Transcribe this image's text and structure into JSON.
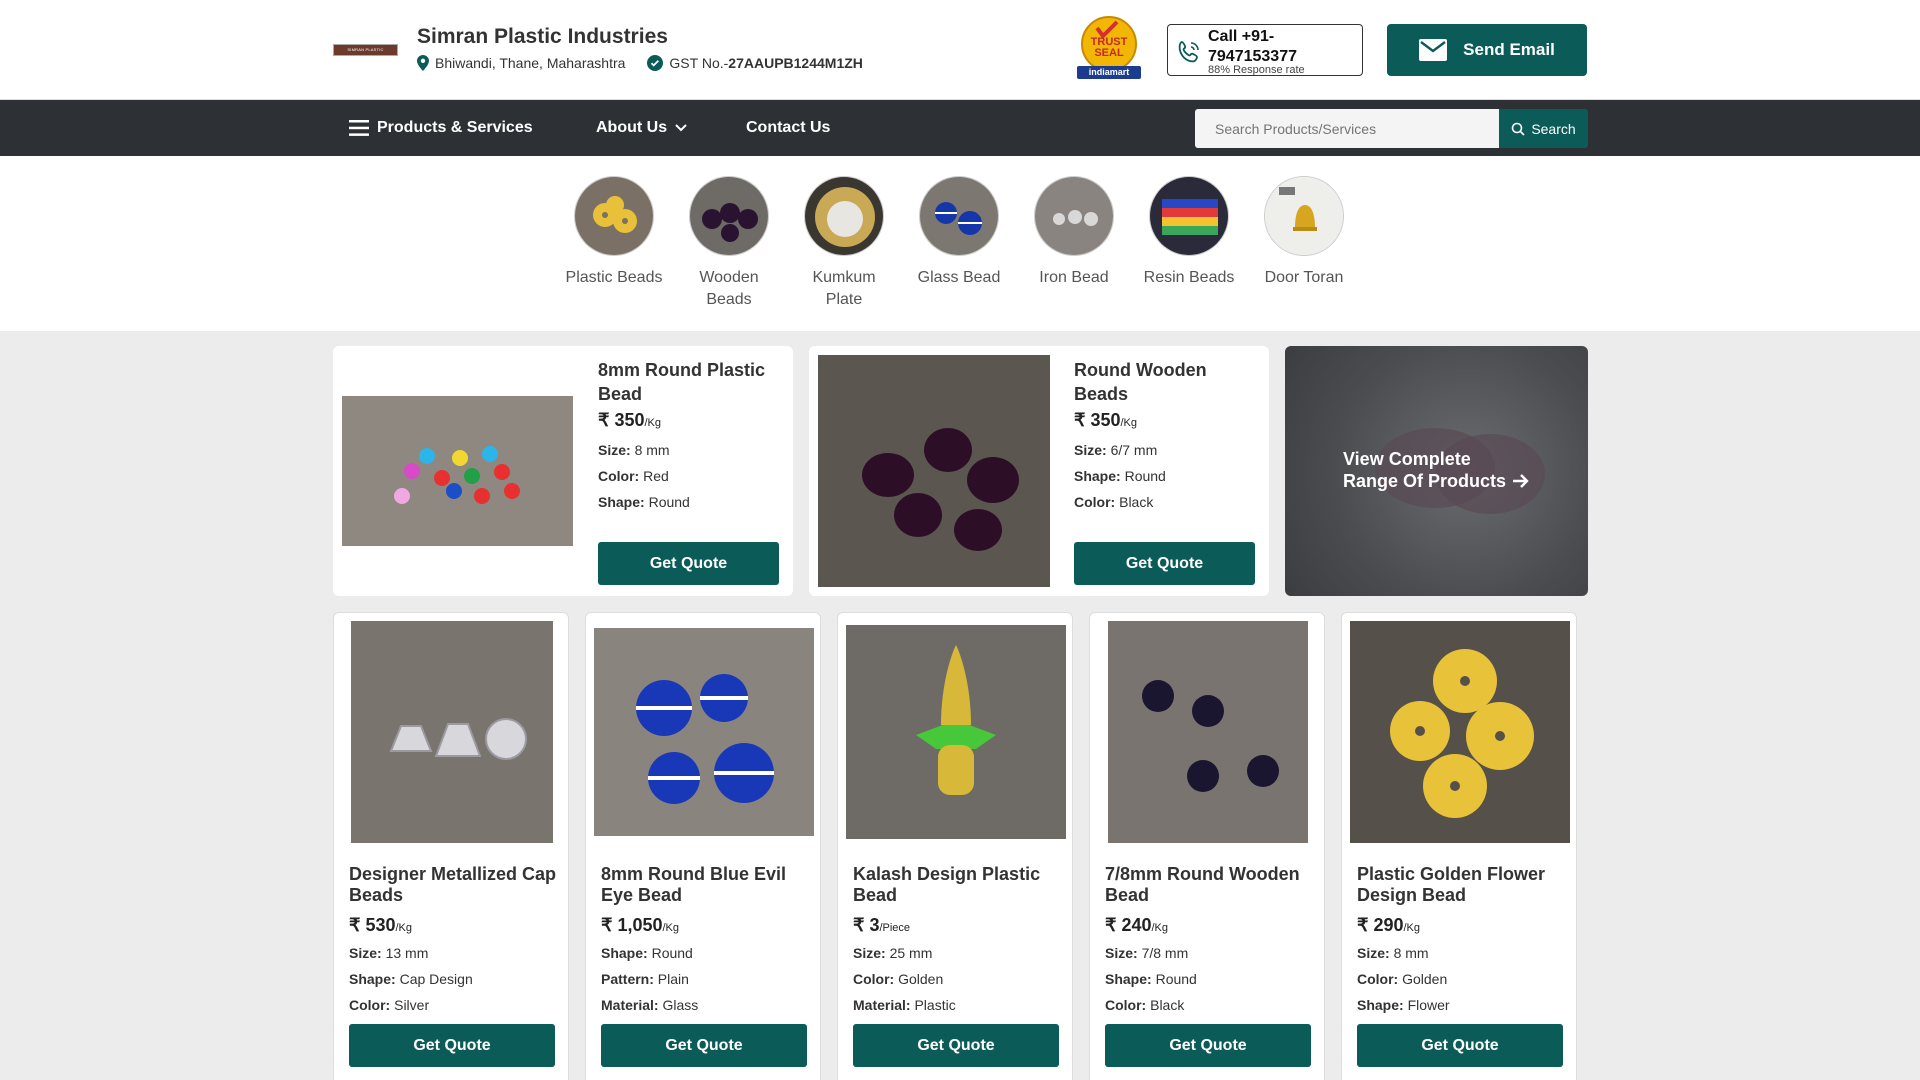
{
  "header": {
    "logo_text": "SIMRAN PLASTIC INDUSTRIES",
    "company_name": "Simran Plastic Industries",
    "location": "Bhiwandi, Thane, Maharashtra",
    "gst_label": "GST No.-",
    "gst_value": "27AAUPB1244M1ZH",
    "trustseal_line1": "TRUST",
    "trustseal_line2": "SEAL",
    "trustseal_brand": "indiamart",
    "call_label": "Call +91-7947153377",
    "response_rate": "88% Response rate",
    "send_email": "Send Email"
  },
  "nav": {
    "products_services": "Products & Services",
    "about_us": "About Us",
    "contact_us": "Contact Us",
    "search_placeholder": "Search Products/Services",
    "search_button": "Search"
  },
  "categories": [
    {
      "label": "Plastic Beads"
    },
    {
      "label": "Wooden Beads"
    },
    {
      "label": "Kumkum Plate"
    },
    {
      "label": "Glass Bead"
    },
    {
      "label": "Iron Bead"
    },
    {
      "label": "Resin Beads"
    },
    {
      "label": "Door Toran"
    }
  ],
  "featured": [
    {
      "title": "8mm Round Plastic Bead",
      "price": "₹ 350",
      "unit": "/Kg",
      "specs": [
        {
          "k": "Size:",
          "v": "8 mm"
        },
        {
          "k": "Color:",
          "v": "Red"
        },
        {
          "k": "Shape:",
          "v": "Round"
        }
      ],
      "cta": "Get Quote"
    },
    {
      "title": "Round Wooden Beads",
      "price": "₹ 350",
      "unit": "/Kg",
      "specs": [
        {
          "k": "Size:",
          "v": "6/7 mm"
        },
        {
          "k": "Shape:",
          "v": "Round"
        },
        {
          "k": "Color:",
          "v": "Black"
        }
      ],
      "cta": "Get Quote"
    }
  ],
  "view_all": {
    "line1": "View Complete",
    "line2": "Range Of Products"
  },
  "products": [
    {
      "title": "Designer Metallized Cap Beads",
      "price": "₹ 530",
      "unit": "/Kg",
      "specs": [
        {
          "k": "Size:",
          "v": "13 mm"
        },
        {
          "k": "Shape:",
          "v": "Cap Design"
        },
        {
          "k": "Color:",
          "v": "Silver"
        }
      ],
      "cta": "Get Quote"
    },
    {
      "title": "8mm Round Blue Evil Eye Bead",
      "price": "₹ 1,050",
      "unit": "/Kg",
      "specs": [
        {
          "k": "Shape:",
          "v": "Round"
        },
        {
          "k": "Pattern:",
          "v": "Plain"
        },
        {
          "k": "Material:",
          "v": "Glass"
        }
      ],
      "cta": "Get Quote"
    },
    {
      "title": "Kalash Design Plastic Bead",
      "price": "₹ 3",
      "unit": "/Piece",
      "specs": [
        {
          "k": "Size:",
          "v": "25 mm"
        },
        {
          "k": "Color:",
          "v": "Golden"
        },
        {
          "k": "Material:",
          "v": "Plastic"
        }
      ],
      "cta": "Get Quote"
    },
    {
      "title": "7/8mm Round Wooden Bead",
      "price": "₹ 240",
      "unit": "/Kg",
      "specs": [
        {
          "k": "Size:",
          "v": "7/8 mm"
        },
        {
          "k": "Shape:",
          "v": "Round"
        },
        {
          "k": "Color:",
          "v": "Black"
        }
      ],
      "cta": "Get Quote"
    },
    {
      "title": "Plastic Golden Flower Design Bead",
      "price": "₹ 290",
      "unit": "/Kg",
      "specs": [
        {
          "k": "Size:",
          "v": "8 mm"
        },
        {
          "k": "Color:",
          "v": "Golden"
        },
        {
          "k": "Shape:",
          "v": "Flower"
        }
      ],
      "cta": "Get Quote"
    }
  ],
  "colors": {
    "brand": "#0b5c59",
    "nav_bg": "#2d3136"
  }
}
